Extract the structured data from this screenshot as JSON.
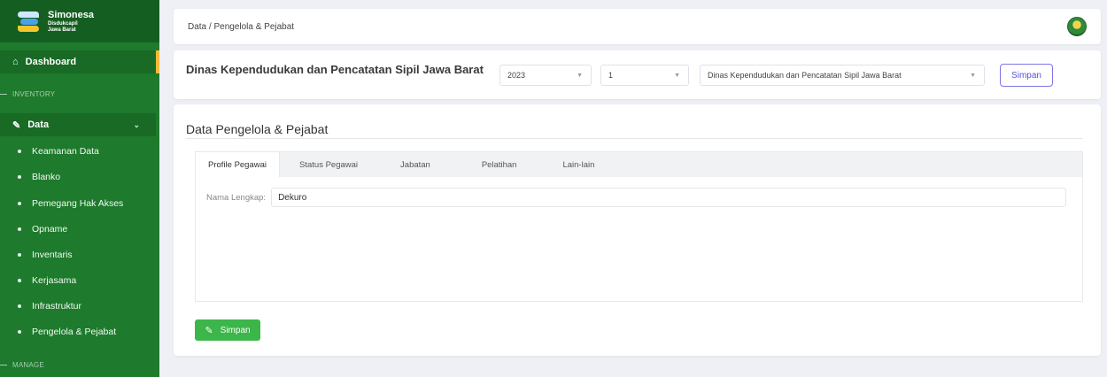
{
  "brand": {
    "title": "Simonesa",
    "line1": "Disdukcapil",
    "line2": "Jawa Barat"
  },
  "sidebar": {
    "dashboard_label": "Dashboard",
    "section_inventory": "INVENTORY",
    "data_label": "Data",
    "items": [
      {
        "label": "Keamanan Data"
      },
      {
        "label": "Blanko"
      },
      {
        "label": "Pemegang Hak Akses"
      },
      {
        "label": "Opname"
      },
      {
        "label": "Inventaris"
      },
      {
        "label": "Kerjasama"
      },
      {
        "label": "Infrastruktur"
      },
      {
        "label": "Pengelola & Pejabat"
      }
    ],
    "section_manage": "MANAGE"
  },
  "header": {
    "breadcrumb": "Data / Pengelola & Pejabat"
  },
  "filter": {
    "title": "Dinas Kependudukan dan Pencatatan Sipil Jawa Barat",
    "year": "2023",
    "period": "1",
    "agency": "Dinas Kependudukan dan Pencatatan Sipil Jawa Barat",
    "save_label": "Simpan"
  },
  "content": {
    "title": "Data Pengelola & Pejabat",
    "tabs": [
      {
        "label": "Profile Pegawai"
      },
      {
        "label": "Status Pegawai"
      },
      {
        "label": "Jabatan"
      },
      {
        "label": "Pelatihan"
      },
      {
        "label": "Lain-lain"
      }
    ],
    "field_label": "Nama Lengkap:",
    "field_value": "Dekuro",
    "save_label": "Simpan"
  },
  "colors": {
    "sidebar": "#1e7a2c",
    "accent": "#f2b93b",
    "save": "#3cb54a",
    "outline": "#5a53d8"
  }
}
